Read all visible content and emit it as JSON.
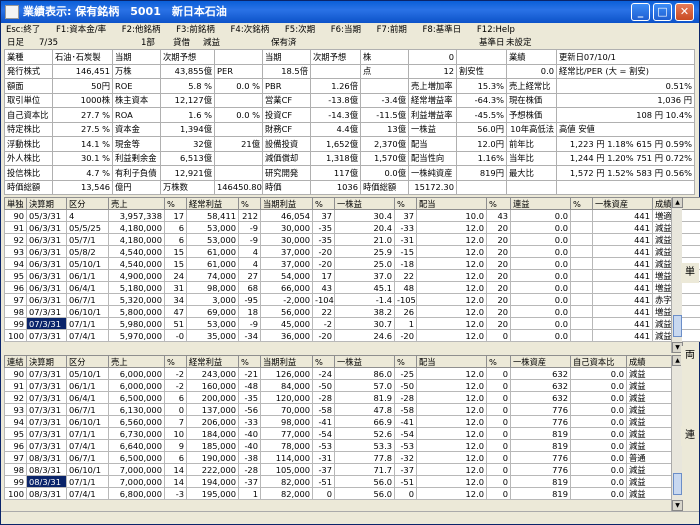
{
  "window": {
    "title": "業績表示: 保有銘柄　5001　新日本石油",
    "minimize": "_",
    "maximize": "□",
    "close": "✕"
  },
  "fkeys": [
    "Esc:終了",
    "F1:資本金/率",
    "F2:他銘柄",
    "F3:前銘柄",
    "F4:次銘柄",
    "F5:次期",
    "F6:当期",
    "F7:前期",
    "F8:基準日",
    "F12:Help"
  ],
  "info": {
    "date_label": "日足",
    "date": "7/35",
    "market": "1部",
    "category": "貸借",
    "status": "減益",
    "holding": "保有済",
    "base_label": "基準日",
    "base_value": "未設定"
  },
  "stock": [
    [
      "業種",
      "石油･石炭製",
      "当期",
      "次期予想",
      "",
      "当期",
      "次期予想",
      "株",
      "0",
      "",
      "業績",
      "更新日07/10/1"
    ],
    [
      "発行株式",
      "146,451",
      "万株",
      "43,855億",
      "PER",
      "18.5倍",
      "",
      "点",
      "12",
      "割安性",
      "0.0",
      "経常比/PER (大 = 割安)"
    ],
    [
      "額面",
      "50円",
      "ROE",
      "5.8 %",
      "0.0 %",
      "PBR",
      "1.26倍",
      "",
      "売上増加率",
      "15.3%",
      "売上経常比",
      "0.51%"
    ],
    [
      "取引単位",
      "1000株",
      "株主資本",
      "12,127億",
      "",
      "営業CF",
      "-13.8億",
      "-3.4億",
      "経常増益率",
      "-64.3%",
      "現在株価",
      "1,036 円"
    ],
    [
      "自己資本比",
      "27.7 %",
      "ROA",
      "1.6 %",
      "0.0 %",
      "投資CF",
      "-14.3億",
      "-11.5億",
      "利益増益率",
      "-45.5%",
      "予想株価",
      "108 円 10.4%"
    ],
    [
      "特定株比",
      "27.5 %",
      "資本金",
      "1,394億",
      "",
      "財務CF",
      "4.4億",
      "13億",
      "一株益",
      "56.0円",
      "10年高低法",
      "高値 安値"
    ],
    [
      "浮動株比",
      "14.1 %",
      "現金等",
      "32億",
      "21億",
      "設備投資",
      "1,652億",
      "2,370億",
      "配当",
      "12.0円",
      "前年比",
      "1,223 円 1.18% 615 円 0.59%"
    ],
    [
      "外人株比",
      "30.1 %",
      "利益剰余金",
      "6,513億",
      "",
      "減価償却",
      "1,318億",
      "1,570億",
      "配当性向",
      "1.16%",
      "当年比",
      "1,244 円 1.20% 751 円 0.72%"
    ],
    [
      "投信株比",
      "4.7 %",
      "有利子負債",
      "12,921億",
      "",
      "研究開発",
      "117億",
      "0.0億",
      "一株純資産",
      "819円",
      "最大比",
      "1,572 円 1.52% 583 円 0.56%"
    ],
    [
      "時価総額",
      "13,546",
      "億円",
      "万株数",
      "146450.80",
      "時価",
      "1036",
      "時価総額",
      "15172.30",
      "",
      "",
      ""
    ]
  ],
  "single": {
    "label": "単独",
    "headers": [
      "単独",
      "決算期",
      "区分",
      "売上",
      "%",
      "経常利益",
      "%",
      "当期利益",
      "%",
      "一株益",
      "%",
      "配当",
      "%",
      "連益",
      "%",
      "一株資産",
      "成績"
    ],
    "rows": [
      [
        "90",
        "05/3/31",
        "4",
        "3,957,338",
        "17",
        "58,411",
        "212",
        "46,054",
        "37",
        "30.4",
        "37",
        "10.0",
        "43",
        "0.0",
        "",
        "441",
        "増適"
      ],
      [
        "91",
        "06/3/31",
        "05/5/25",
        "4,180,000",
        "6",
        "53,000",
        "-9",
        "30,000",
        "-35",
        "20.4",
        "-33",
        "12.0",
        "20",
        "0.0",
        "",
        "441",
        "減益"
      ],
      [
        "92",
        "06/3/31",
        "05/7/1",
        "4,180,000",
        "6",
        "53,000",
        "-9",
        "30,000",
        "-35",
        "21.0",
        "-31",
        "12.0",
        "20",
        "0.0",
        "",
        "441",
        "減益"
      ],
      [
        "93",
        "06/3/31",
        "05/8/2",
        "4,540,000",
        "15",
        "61,000",
        "4",
        "37,000",
        "-20",
        "25.9",
        "-15",
        "12.0",
        "20",
        "0.0",
        "",
        "441",
        "減益"
      ],
      [
        "94",
        "06/3/31",
        "05/10/1",
        "4,540,000",
        "15",
        "61,000",
        "4",
        "37,000",
        "-20",
        "25.0",
        "-18",
        "12.0",
        "20",
        "0.0",
        "",
        "441",
        "減益"
      ],
      [
        "95",
        "06/3/31",
        "06/1/1",
        "4,900,000",
        "24",
        "74,000",
        "27",
        "54,000",
        "17",
        "37.0",
        "22",
        "12.0",
        "20",
        "0.0",
        "",
        "441",
        "増益"
      ],
      [
        "96",
        "06/3/31",
        "06/4/1",
        "5,180,000",
        "31",
        "98,000",
        "68",
        "66,000",
        "43",
        "45.1",
        "48",
        "12.0",
        "20",
        "0.0",
        "",
        "441",
        "増益"
      ],
      [
        "97",
        "06/3/31",
        "06/7/1",
        "5,320,000",
        "34",
        "3,000",
        "-95",
        "-2,000",
        "-104",
        "-1.4",
        "-105",
        "12.0",
        "20",
        "0.0",
        "",
        "441",
        "赤字"
      ],
      [
        "98",
        "07/3/31",
        "06/10/1",
        "5,800,000",
        "47",
        "69,000",
        "18",
        "56,000",
        "22",
        "38.2",
        "26",
        "12.0",
        "20",
        "0.0",
        "",
        "441",
        "増益"
      ],
      [
        "99",
        "07/3/31",
        "07/1/1",
        "5,980,000",
        "51",
        "53,000",
        "-9",
        "45,000",
        "-2",
        "30.7",
        "1",
        "12.0",
        "20",
        "0.0",
        "",
        "441",
        "減益"
      ],
      [
        "100",
        "07/3/31",
        "07/4/1",
        "5,970,000",
        "-0",
        "35,000",
        "-34",
        "36,000",
        "-20",
        "24.6",
        "-20",
        "12.0",
        "0",
        "0.0",
        "",
        "441",
        "減益"
      ]
    ]
  },
  "consolidated": {
    "label": "連結",
    "headers": [
      "連結",
      "決算期",
      "区分",
      "売上",
      "%",
      "経常利益",
      "%",
      "当期利益",
      "%",
      "一株益",
      "%",
      "配当",
      "%",
      "一株資産",
      "自己資本比",
      "成績"
    ],
    "rows": [
      [
        "90",
        "07/3/31",
        "05/10/1",
        "6,000,000",
        "-2",
        "243,000",
        "-21",
        "126,000",
        "-24",
        "86.0",
        "-25",
        "12.0",
        "0",
        "632",
        "0.0",
        "減益"
      ],
      [
        "91",
        "07/3/31",
        "06/1/1",
        "6,000,000",
        "-2",
        "160,000",
        "-48",
        "84,000",
        "-50",
        "57.0",
        "-50",
        "12.0",
        "0",
        "632",
        "0.0",
        "減益"
      ],
      [
        "92",
        "07/3/31",
        "06/4/1",
        "6,500,000",
        "6",
        "200,000",
        "-35",
        "120,000",
        "-28",
        "81.9",
        "-28",
        "12.0",
        "0",
        "632",
        "0.0",
        "減益"
      ],
      [
        "93",
        "07/3/31",
        "06/7/1",
        "6,130,000",
        "0",
        "137,000",
        "-56",
        "70,000",
        "-58",
        "47.8",
        "-58",
        "12.0",
        "0",
        "776",
        "0.0",
        "減益"
      ],
      [
        "94",
        "07/3/31",
        "06/10/1",
        "6,560,000",
        "7",
        "206,000",
        "-33",
        "98,000",
        "-41",
        "66.9",
        "-41",
        "12.0",
        "0",
        "776",
        "0.0",
        "減益"
      ],
      [
        "95",
        "07/3/31",
        "07/1/1",
        "6,730,000",
        "10",
        "184,000",
        "-40",
        "77,000",
        "-54",
        "52.6",
        "-54",
        "12.0",
        "0",
        "819",
        "0.0",
        "減益"
      ],
      [
        "96",
        "07/3/31",
        "07/4/1",
        "6,640,000",
        "9",
        "185,000",
        "-40",
        "78,000",
        "-53",
        "53.3",
        "-53",
        "12.0",
        "0",
        "819",
        "0.0",
        "減益"
      ],
      [
        "97",
        "08/3/31",
        "06/7/1",
        "6,500,000",
        "6",
        "190,000",
        "-38",
        "114,000",
        "-31",
        "77.8",
        "-32",
        "12.0",
        "0",
        "776",
        "0.0",
        "普通"
      ],
      [
        "98",
        "08/3/31",
        "06/10/1",
        "7,000,000",
        "14",
        "222,000",
        "-28",
        "105,000",
        "-37",
        "71.7",
        "-37",
        "12.0",
        "0",
        "776",
        "0.0",
        "減益"
      ],
      [
        "99",
        "08/3/31",
        "07/1/1",
        "7,000,000",
        "14",
        "194,000",
        "-37",
        "82,000",
        "-51",
        "56.0",
        "-51",
        "12.0",
        "0",
        "819",
        "0.0",
        "減益"
      ],
      [
        "100",
        "08/3/31",
        "07/4/1",
        "6,800,000",
        "-3",
        "195,000",
        "1",
        "82,000",
        "0",
        "56.0",
        "0",
        "12.0",
        "0",
        "819",
        "0.0",
        "減益"
      ]
    ]
  },
  "side": {
    "tan": "単",
    "ren_arrow": "両",
    "ren": "連"
  }
}
